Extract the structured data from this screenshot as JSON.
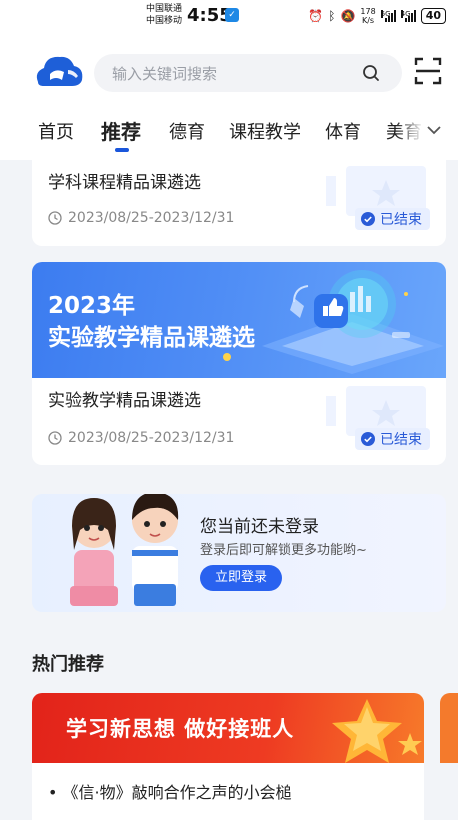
{
  "status_bar": {
    "carrier_1": "中国联通",
    "carrier_2": "中国移动",
    "time": "4:55",
    "net_speed_value": "178",
    "net_speed_unit": "K/s",
    "sim1_tag": "5G",
    "sim2_tag": "4G",
    "battery": "40"
  },
  "header": {
    "search_placeholder": "输入关键词搜索",
    "tabs": [
      {
        "label": "首页"
      },
      {
        "label": "推荐"
      },
      {
        "label": "德育"
      },
      {
        "label": "课程教学"
      },
      {
        "label": "体育"
      },
      {
        "label": "美育"
      }
    ],
    "active_tab": "推荐"
  },
  "courses": [
    {
      "title": "学科课程精品课遴选",
      "date_range": "2023/08/25-2023/12/31",
      "status": "已结束"
    },
    {
      "banner_line1": "2023年",
      "banner_line2": "实验教学精品课遴选",
      "title": "实验教学精品课遴选",
      "date_range": "2023/08/25-2023/12/31",
      "status": "已结束"
    }
  ],
  "login_card": {
    "title": "您当前还未登录",
    "subtitle": "登录后即可解锁更多功能哟~",
    "button": "立即登录"
  },
  "hot": {
    "section_title": "热门推荐",
    "banner_text": "学习新思想 做好接班人",
    "item": "•  《信·物》敲响合作之声的小会槌"
  },
  "colors": {
    "accent": "#1a56db",
    "badge_bg": "#e8efff",
    "hot_red": "#e2231a"
  }
}
